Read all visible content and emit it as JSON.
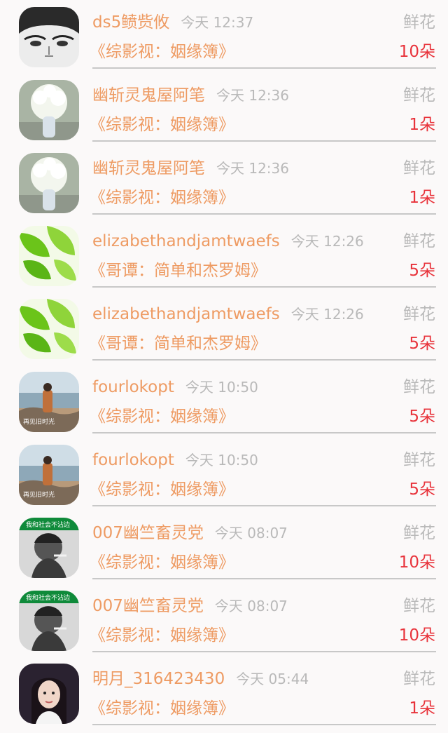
{
  "rows": [
    {
      "name": "ds5鲼赀攸",
      "time": "今天 12:37",
      "gift": "鲜花",
      "book": "《综影视：姻缘簿》",
      "count": "10朵",
      "avatar": "woman-sketch"
    },
    {
      "name": "幽斩灵鬼屋阿笔",
      "time": "今天 12:36",
      "gift": "鲜花",
      "book": "《综影视：姻缘簿》",
      "count": "1朵",
      "avatar": "flowers"
    },
    {
      "name": "幽斩灵鬼屋阿笔",
      "time": "今天 12:36",
      "gift": "鲜花",
      "book": "《综影视：姻缘簿》",
      "count": "1朵",
      "avatar": "flowers"
    },
    {
      "name": "elizabethandjamtwaefs",
      "time": "今天 12:26",
      "gift": "鲜花",
      "book": "《哥谭：简单和杰罗姆》",
      "count": "5朵",
      "avatar": "green-leaves"
    },
    {
      "name": "elizabethandjamtwaefs",
      "time": "今天 12:26",
      "gift": "鲜花",
      "book": "《哥谭：简单和杰罗姆》",
      "count": "5朵",
      "avatar": "green-leaves"
    },
    {
      "name": "fourlokopt",
      "time": "今天 10:50",
      "gift": "鲜花",
      "book": "《综影视：姻缘簿》",
      "count": "5朵",
      "avatar": "seaside"
    },
    {
      "name": "fourlokopt",
      "time": "今天 10:50",
      "gift": "鲜花",
      "book": "《综影视：姻缘簿》",
      "count": "5朵",
      "avatar": "seaside"
    },
    {
      "name": "007幽竺畜灵党",
      "time": "今天 08:07",
      "gift": "鲜花",
      "book": "《综影视：姻缘簿》",
      "count": "10朵",
      "avatar": "man-bw"
    },
    {
      "name": "007幽竺畜灵党",
      "time": "今天 08:07",
      "gift": "鲜花",
      "book": "《综影视：姻缘簿》",
      "count": "10朵",
      "avatar": "man-bw"
    },
    {
      "name": "明月_316423430",
      "time": "今天 05:44",
      "gift": "鲜花",
      "book": "《综影视：姻缘簿》",
      "count": "1朵",
      "avatar": "woman-portrait"
    }
  ]
}
